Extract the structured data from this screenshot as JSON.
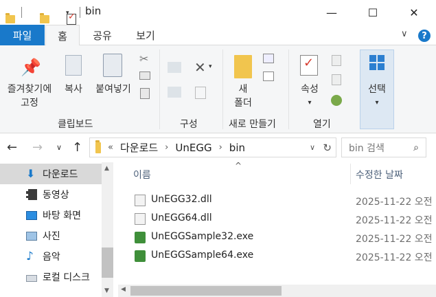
{
  "window": {
    "title": "bin",
    "minimize": "—",
    "maximize": "☐",
    "close": "✕"
  },
  "ribbon_tabs": {
    "file": "파일",
    "home": "홈",
    "share": "공유",
    "view": "보기",
    "collapse": "∨"
  },
  "ribbon": {
    "pin_label_1": "즐겨찾기에",
    "pin_label_2": "고정",
    "copy": "복사",
    "paste": "붙여넣기",
    "clipboard_group": "클립보드",
    "organize_group": "구성",
    "new_folder_1": "새",
    "new_folder_2": "폴더",
    "new_group": "새로 만들기",
    "properties": "속성",
    "open_group": "열기",
    "select": "선택",
    "caret": "▾"
  },
  "address": {
    "prefix": "«",
    "crumbs": [
      "다운로드",
      "UnEGG",
      "bin"
    ],
    "separator": "›",
    "search_placeholder": "bin 검색"
  },
  "nav_pane": {
    "items": [
      {
        "label": "다운로드",
        "icon": "download-icon"
      },
      {
        "label": "동영상",
        "icon": "video-icon"
      },
      {
        "label": "바탕 화면",
        "icon": "desktop-icon"
      },
      {
        "label": "사진",
        "icon": "pictures-icon"
      },
      {
        "label": "음악",
        "icon": "music-icon"
      },
      {
        "label": "로컬 디스크",
        "icon": "disk-icon"
      }
    ]
  },
  "file_list": {
    "columns": {
      "name": "이름",
      "modified": "수정한 날짜"
    },
    "sort_indicator": "^",
    "files": [
      {
        "name": "UnEGG32.dll",
        "date": "2025-11-22 오전",
        "type": "dll"
      },
      {
        "name": "UnEGG64.dll",
        "date": "2025-11-22 오전",
        "type": "dll"
      },
      {
        "name": "UnEGGSample32.exe",
        "date": "2025-11-22 오전",
        "type": "exe"
      },
      {
        "name": "UnEGGSample64.exe",
        "date": "2025-11-22 오전",
        "type": "exe"
      }
    ]
  },
  "colors": {
    "accent": "#1979ca",
    "selection": "#d9d9d9"
  }
}
